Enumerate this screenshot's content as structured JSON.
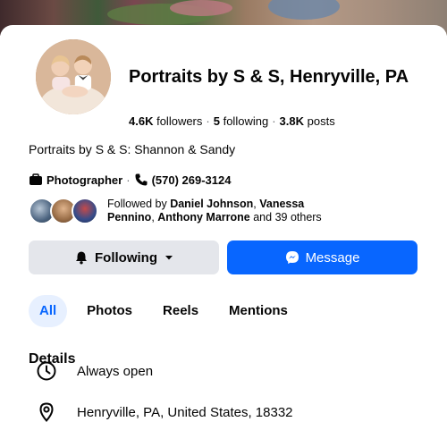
{
  "page": {
    "name": "Portraits by S & S, Henryville, PA",
    "stats": {
      "followers_count": "4.6K",
      "followers_label": "followers",
      "following_count": "5",
      "following_label": "following",
      "posts_count": "3.8K",
      "posts_label": "posts"
    },
    "intro": "Portraits by S & S:  Shannon & Sandy",
    "category": "Photographer",
    "phone": "(570) 269-3124",
    "followed_by": {
      "prefix": "Followed by",
      "names": [
        "Daniel Johnson",
        "Vanessa Pennino",
        "Anthony Marrone"
      ],
      "others": "and 39 others"
    }
  },
  "actions": {
    "following_label": "Following",
    "message_label": "Message"
  },
  "tabs": [
    {
      "label": "All",
      "active": true
    },
    {
      "label": "Photos",
      "active": false
    },
    {
      "label": "Reels",
      "active": false
    },
    {
      "label": "Mentions",
      "active": false
    }
  ],
  "details": {
    "title": "Details",
    "items": [
      {
        "icon": "clock-icon",
        "text": "Always open"
      },
      {
        "icon": "location-pin-icon",
        "text": "Henryville, PA, United States, 18332"
      }
    ]
  },
  "colors": {
    "accent": "#0866ff",
    "tab_active_bg": "#e7f0ff",
    "secondary_button_bg": "#e4e6eb",
    "muted_text": "#65676b"
  }
}
